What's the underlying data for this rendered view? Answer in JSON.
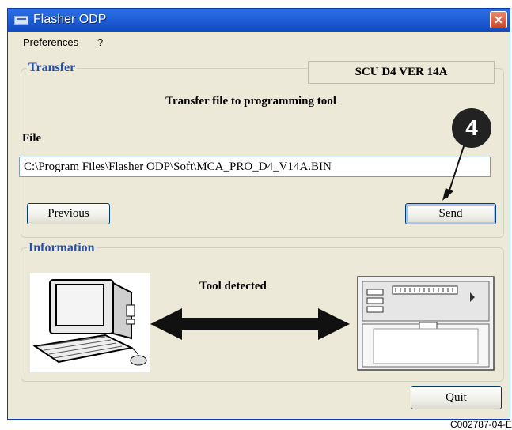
{
  "window": {
    "title": "Flasher ODP",
    "close_glyph": "✕"
  },
  "menu": {
    "items": [
      "Preferences",
      "?"
    ]
  },
  "transfer": {
    "group_label": "Transfer",
    "version": "SCU D4 VER  14A",
    "heading": "Transfer file to programming tool",
    "file_label": "File",
    "file_value": "C:\\Program Files\\Flasher ODP\\Soft\\MCA_PRO_D4_V14A.BIN",
    "previous_label": "Previous",
    "send_label": "Send"
  },
  "information": {
    "group_label": "Information",
    "status": "Tool detected",
    "computer_icon": "computer-icon",
    "device_icon": "programming-tool-icon",
    "arrow_icon": "double-arrow-icon"
  },
  "quit_label": "Quit",
  "callout": {
    "number": "4"
  },
  "figure_code": "C002787-04-E",
  "colors": {
    "titlebar": "#1f5fd8",
    "group_label": "#2850a8",
    "window_bg": "#ece9d8",
    "callout": "#222222"
  }
}
